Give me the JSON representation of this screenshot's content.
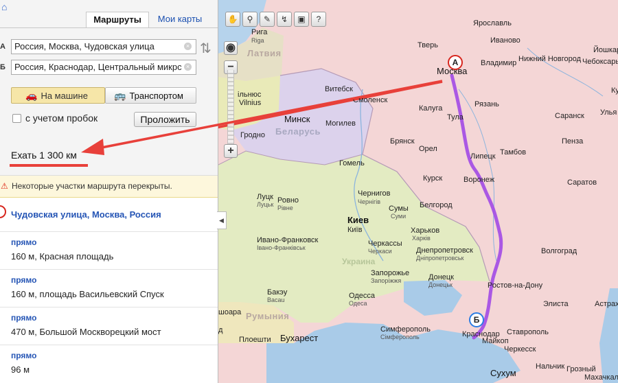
{
  "tabs": {
    "routes": "Маршруты",
    "my_maps": "Мои карты"
  },
  "route_form": {
    "point_a_label": "А",
    "point_b_label": "Б",
    "point_a_value": "Россия, Москва, Чудовская улица",
    "point_b_value": "Россия, Краснодар, Центральный микрс",
    "mode_car": "На машине",
    "mode_transport": "Транспортом",
    "traffic_label": "с учетом пробок",
    "build_button": "Проложить"
  },
  "distance": "Ехать 1 300 км",
  "warning": "Некоторые участки маршрута перекрыты.",
  "start_point": "Чудовская улица, Москва, Россия",
  "steps": [
    {
      "direction": "прямо",
      "description": "160 м, Красная площадь"
    },
    {
      "direction": "прямо",
      "description": "160 м, площадь Васильевский Спуск"
    },
    {
      "direction": "прямо",
      "description": "470 м, Большой Москворецкий мост"
    },
    {
      "direction": "прямо",
      "description": "96 м"
    }
  ],
  "map": {
    "marker_a": "А",
    "marker_b": "Б",
    "cities": {
      "riga": "Рига",
      "riga_lat": "Riga",
      "latvia": "Латвия",
      "vilnius_lt": "ільнюс",
      "vilnius": "Vilnius",
      "minsk": "Минск",
      "belarus": "Беларусь",
      "grodno": "Гродно",
      "vitebsk": "Витебск",
      "smolensk": "Смоленск",
      "mogilev": "Могилев",
      "gomel": "Гомель",
      "bryansk": "Брянск",
      "orel": "Орел",
      "kaluga": "Калуга",
      "tula": "Тула",
      "moscow": "Москва",
      "tver": "Тверь",
      "yaroslavl": "Ярославль",
      "ivanovo": "Иваново",
      "vladimir": "Владимир",
      "n_novgorod": "Нижний Новгород",
      "yoshkar": "Йошкар-",
      "cheboksary": "Чебоксары",
      "ku": "Ку",
      "ryazan": "Рязань",
      "saransk": "Саранск",
      "ulyan": "Улья",
      "penza": "Пенза",
      "tambov": "Тамбов",
      "lipetsk": "Липецк",
      "kursk": "Курск",
      "voronezh": "Воронеж",
      "saratov": "Саратов",
      "belgorod": "Белгород",
      "kharkov": "Харьков",
      "kharkiv": "Харків",
      "sumy": "Сумы",
      "sumy_ua": "Суми",
      "chernigov": "Чернигов",
      "chernihiv": "Чернігів",
      "kiev": "Киев",
      "kyiv": "Київ",
      "lutsk": "Луцк",
      "lutsk_ua": "Луцьк",
      "rovno": "Ровно",
      "rivne": "Рівне",
      "ivano": "Ивано-Франковск",
      "ivano_ua": "Івано-Франківськ",
      "cherkassy": "Черкассы",
      "cherkasy": "Черкаси",
      "ukraine": "Украина",
      "dnepr": "Днепропетровск",
      "dnipro": "Дніпропетровськ",
      "zaporozhye": "Запорожье",
      "zaporizhzhia": "Запоріжжя",
      "donetsk": "Донецк",
      "donetsk_ua": "Донецьк",
      "rostov": "Ростов-на-Дону",
      "volgograd": "Волгоград",
      "elista": "Элиста",
      "astrakhan": "Астрах",
      "bacau": "Бакэу",
      "bacau_lat": "Bacau",
      "romania": "Румыния",
      "odessa": "Одесса",
      "odesa": "Одеса",
      "simferopol": "Симферополь",
      "simferopol_ua": "Сімферополь",
      "krasnodar": "Краснодар",
      "maykop": "Майкоп",
      "stavropol": "Ставрополь",
      "cherkessk": "Черкесск",
      "nalchik": "Нальчик",
      "grozny": "Грозный",
      "makhachkala": "Махачкал",
      "sukhum": "Сухум",
      "ploiesti": "Плоешти",
      "bucharest": "Бухарест",
      "chisoara": "шоара",
      "d": "д"
    }
  },
  "colors": {
    "route": "#a24ae6",
    "annotation_arrow": "#e8403a",
    "accent_link": "#2555b5"
  }
}
